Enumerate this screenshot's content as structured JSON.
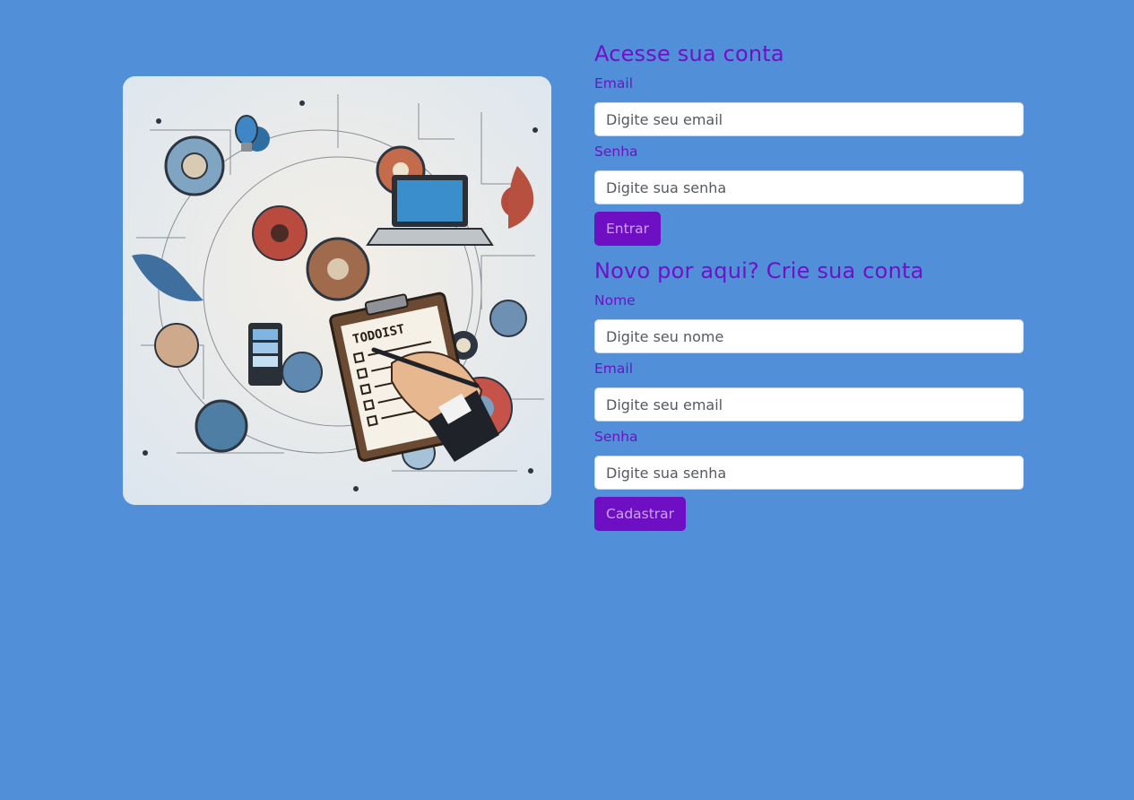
{
  "login": {
    "title": "Acesse sua conta",
    "email_label": "Email",
    "email_placeholder": "Digite seu email",
    "password_label": "Senha",
    "password_placeholder": "Digite sua senha",
    "submit_label": "Entrar"
  },
  "signup": {
    "title": "Novo por aqui? Crie sua conta",
    "name_label": "Nome",
    "name_placeholder": "Digite seu nome",
    "email_label": "Email",
    "email_placeholder": "Digite seu email",
    "password_label": "Senha",
    "password_placeholder": "Digite sua senha",
    "submit_label": "Cadastrar"
  },
  "illustration": {
    "clipboard_text": "TODOIST"
  },
  "colors": {
    "background": "#528fd9",
    "accent": "#6f12c6",
    "button_bg": "#6f0fc4",
    "button_text": "#c9a6ee"
  }
}
